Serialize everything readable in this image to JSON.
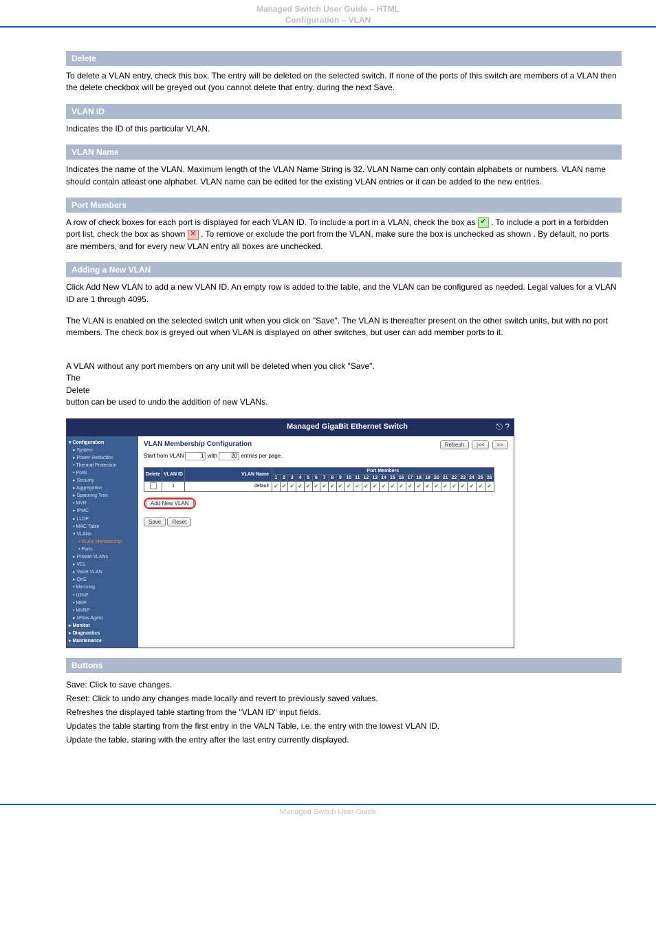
{
  "header": {
    "title": "Managed Switch User Guide – HTML",
    "subtitle": "Configuration – VLAN"
  },
  "sections": {
    "delete": {
      "title": "Delete",
      "body": "To delete a VLAN entry, check this box. The entry will be deleted on the selected switch. If none of the ports of this switch are members of a VLAN then the delete checkbox will be greyed out (you cannot delete that entry. during the next Save."
    },
    "vlan_id": {
      "title": "VLAN ID",
      "body": "Indicates the ID of this particular VLAN."
    },
    "vlan_name": {
      "title": "VLAN Name",
      "body": "Indicates the name of the VLAN. Maximum length of the VLAN Name String is 32. VLAN Name can only contain alphabets or numbers. VLAN name should contain atleast one alphabet. VLAN name can be edited for the existing VLAN entries or it can be added to the new entries."
    },
    "port_members": {
      "title": "Port Members",
      "before_tick": "A row of check boxes for each port is displayed for each VLAN ID. To include a port in a VLAN, check the box as ",
      "after_tick": ". To include a port in a forbidden port list, check the box as shown",
      "after_cross1": ". To remove or exclude the port from the VLAN, make sure the box is unchecked as shown",
      "after_cross2": ". By default, no ports are members, and for every new VLAN entry all boxes are unchecked."
    },
    "adding": {
      "title": "Adding a New VLAN",
      "p1_before": "Click ",
      "add_label": "Add New VLAN",
      "p1_after": " to add a new VLAN ID. An empty row is added to the table, and the VLAN can be configured as needed. Legal values for a VLAN ID are 1 through 4095.",
      "p2": "The VLAN is enabled on the selected switch unit when you click on \"Save\". The VLAN is thereafter present on the other switch units, but with no port members. The check box is greyed out when VLAN is displayed on other switches, but user can add member ports to it.",
      "p3_before": "A VLAN without any port members on any unit will be deleted when you click \"Save\".\nThe ",
      "delete_label": "Delete",
      "p3_after": " button can be used to undo the addition of new VLANs."
    },
    "buttons": {
      "title": "Buttons",
      "save": "Save: Click to save changes.",
      "reset": "Reset: Click to undo any changes made locally and revert to previously saved values.",
      "refresh": "Refreshes the displayed table starting from the \"VLAN ID\" input fields.",
      "first": "Updates the table starting from the first entry in the VALN Table, i.e. the entry with the lowest VLAN ID.",
      "next": "Update the table, staring with the entry after the last entry currently displayed."
    }
  },
  "screenshot": {
    "app_title": "Managed GigaBit Ethernet Switch",
    "panel_title": "VLAN Membership Configuration",
    "start_from_label": "Start from VLAN",
    "start_from_value": "1",
    "with_label": "with",
    "with_value": "20",
    "entries_label": "entries per page.",
    "col_delete": "Delete",
    "col_vlanid": "VLAN ID",
    "col_vlanname": "VLAN Name",
    "col_portmembers": "Port Members",
    "row_vlanid": "1",
    "row_vlanname": "default",
    "btn_addnew": "Add New VLAN",
    "btn_save": "Save",
    "btn_reset": "Reset",
    "btn_refresh": "Refresh",
    "btn_first": "|<<",
    "btn_next": ">>",
    "nav": {
      "config": "▾ Configuration",
      "system": "▸ System",
      "power": "▸ Power Reduction",
      "thermal": "• Thermal Protection",
      "ports": "• Ports",
      "security": "▸ Security",
      "agg": "▸ Aggregation",
      "span": "▸ Spanning Tree",
      "mvr": "• MVR",
      "ipmc": "▸ IPMC",
      "lldp": "▸ LLDP",
      "mac": "• MAC Table",
      "vlans": "▾ VLANs",
      "vlanm": "• VLAN Membership",
      "vports": "• Ports",
      "pvlans": "▸ Private VLANs",
      "vcl": "▸ VCL",
      "voice": "▸ Voice VLAN",
      "qos": "▸ QoS",
      "mirror": "• Mirroring",
      "upnp": "• UPnP",
      "mrp": "• MRP",
      "mvrp": "• MVRP",
      "sflow": "▸ sFlow Agent",
      "monitor": "▸ Monitor",
      "diag": "▸ Diagnostics",
      "maint": "▸ Maintenance"
    }
  },
  "footer": "Managed Switch User Guide"
}
